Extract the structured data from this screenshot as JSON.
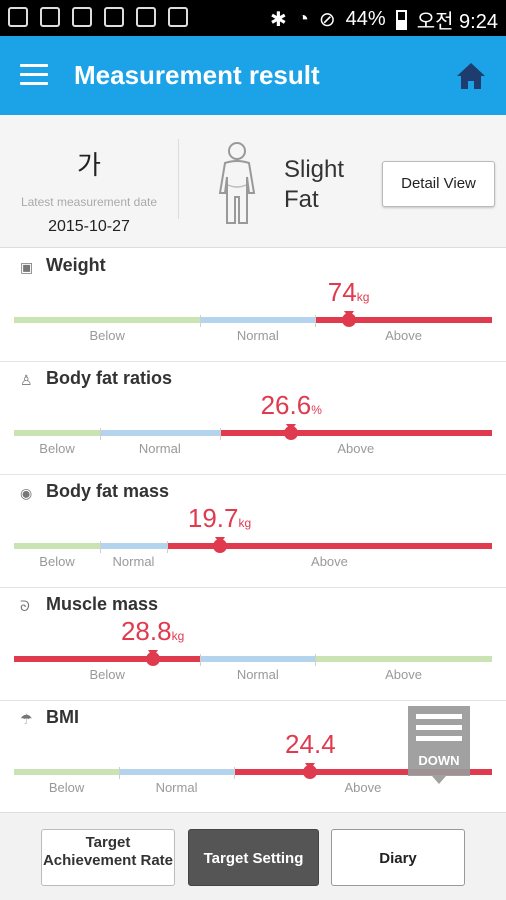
{
  "status_bar": {
    "battery": "44%",
    "time": "오전 9:24",
    "icons_left": [
      "voicemail-icon",
      "photo-icon",
      "mail-icon",
      "sim-icon",
      "gallery-icon",
      "image-icon"
    ],
    "icons_right": [
      "bluetooth-icon",
      "wifi-icon",
      "do-not-disturb-icon",
      "battery-icon"
    ]
  },
  "app_bar": {
    "title": "Measurement result",
    "menu_icon": "hamburger-menu-icon",
    "home_icon": "home-icon",
    "color": "#1ba2e7"
  },
  "summary": {
    "avatar_char": "가",
    "latest_label": "Latest measurement date",
    "latest_date": "2015-10-27",
    "body_type": "Slight Fat",
    "detail_button": "Detail View"
  },
  "metrics": [
    {
      "title": "Weight",
      "icon": "scale-icon",
      "value": "74",
      "unit": "kg",
      "position_pct": 70,
      "segments": [
        {
          "label": "Below",
          "start_pct": 0,
          "end_pct": 39,
          "color": "#c9e3b2"
        },
        {
          "label": "Normal",
          "start_pct": 39,
          "end_pct": 63,
          "color": "#b4d4ee"
        },
        {
          "label": "Above",
          "start_pct": 63,
          "end_pct": 100,
          "color": "#e03a4f"
        }
      ]
    },
    {
      "title": "Body fat ratios",
      "icon": "body-fat-ratio-icon",
      "value": "26.6",
      "unit": "%",
      "position_pct": 58,
      "segments": [
        {
          "label": "Below",
          "start_pct": 0,
          "end_pct": 18,
          "color": "#c9e3b2"
        },
        {
          "label": "Normal",
          "start_pct": 18,
          "end_pct": 43,
          "color": "#b4d4ee"
        },
        {
          "label": "Above",
          "start_pct": 43,
          "end_pct": 100,
          "color": "#e03a4f"
        }
      ]
    },
    {
      "title": "Body fat mass",
      "icon": "body-fat-mass-icon",
      "value": "19.7",
      "unit": "kg",
      "position_pct": 43,
      "segments": [
        {
          "label": "Below",
          "start_pct": 0,
          "end_pct": 18,
          "color": "#c9e3b2"
        },
        {
          "label": "Normal",
          "start_pct": 18,
          "end_pct": 32,
          "color": "#b4d4ee"
        },
        {
          "label": "Above",
          "start_pct": 32,
          "end_pct": 100,
          "color": "#e03a4f"
        }
      ]
    },
    {
      "title": "Muscle mass",
      "icon": "muscle-icon",
      "value": "28.8",
      "unit": "kg",
      "position_pct": 29,
      "segments": [
        {
          "label": "Below",
          "start_pct": 0,
          "end_pct": 39,
          "color": "#e03a4f"
        },
        {
          "label": "Normal",
          "start_pct": 39,
          "end_pct": 63,
          "color": "#b4d4ee"
        },
        {
          "label": "Above",
          "start_pct": 63,
          "end_pct": 100,
          "color": "#c9e3b2"
        }
      ]
    },
    {
      "title": "BMI",
      "icon": "bmi-icon",
      "value": "24.4",
      "unit": "",
      "position_pct": 62,
      "segments": [
        {
          "label": "Below",
          "start_pct": 0,
          "end_pct": 22,
          "color": "#c9e3b2"
        },
        {
          "label": "Normal",
          "start_pct": 22,
          "end_pct": 46,
          "color": "#b4d4ee"
        },
        {
          "label": "Above",
          "start_pct": 46,
          "end_pct": 100,
          "color": "#e03a4f"
        }
      ]
    }
  ],
  "down_button": {
    "label": "DOWN",
    "icon": "list-down-icon"
  },
  "bottom_bar": {
    "achievement": "Target Achievement Rate",
    "target_setting": "Target Setting",
    "diary": "Diary"
  }
}
